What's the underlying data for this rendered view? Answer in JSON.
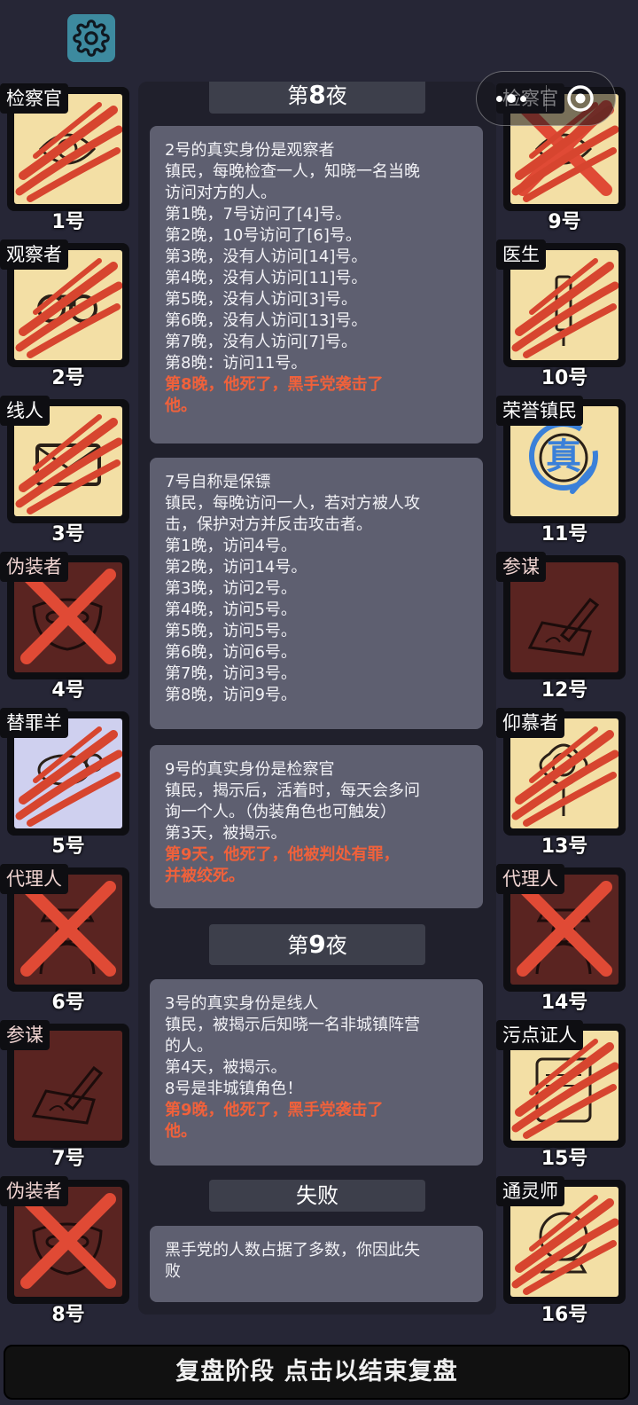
{
  "settings_icon": "gear-icon",
  "capsule": {
    "more_icon": "more-dots-icon",
    "close_icon": "record-close-icon"
  },
  "players": [
    {
      "role": "检察官",
      "number": "1号",
      "team_color": "#ffffff",
      "portrait": "cream",
      "status": "claw",
      "icon": "badge-icon"
    },
    {
      "role": "观察者",
      "number": "2号",
      "team_color": "#ffffff",
      "portrait": "cream",
      "status": "claw",
      "icon": "binoculars-icon"
    },
    {
      "role": "线人",
      "number": "3号",
      "team_color": "#ffffff",
      "portrait": "cream",
      "status": "claw",
      "icon": "envelope-icon"
    },
    {
      "role": "伪装者",
      "number": "4号",
      "team_color": "#f1d5d2",
      "portrait": "maroon",
      "status": "cross",
      "icon": "mask-icon"
    },
    {
      "role": "替罪羊",
      "number": "5号",
      "team_color": "#ffffff",
      "portrait": "lav",
      "status": "claw",
      "icon": "sheep-icon"
    },
    {
      "role": "代理人",
      "number": "6号",
      "team_color": "#f1d5d2",
      "portrait": "maroon",
      "status": "cross",
      "icon": "agent-icon"
    },
    {
      "role": "参谋",
      "number": "7号",
      "team_color": "#f1d5d2",
      "portrait": "maroon",
      "status": "none",
      "icon": "pen-icon"
    },
    {
      "role": "伪装者",
      "number": "8号",
      "team_color": "#f1d5d2",
      "portrait": "maroon",
      "status": "cross",
      "icon": "mask-icon"
    },
    {
      "role": "检察官",
      "number": "9号",
      "team_color": "#ffffff",
      "portrait": "cream",
      "status": "cross-claw",
      "icon": "badge-icon"
    },
    {
      "role": "医生",
      "number": "10号",
      "team_color": "#ffffff",
      "portrait": "cream",
      "status": "claw",
      "icon": "syringe-icon"
    },
    {
      "role": "荣誉镇民",
      "number": "11号",
      "team_color": "#ffffff",
      "portrait": "cream",
      "status": "true-seal",
      "icon": "medal-icon",
      "seal_text": "真"
    },
    {
      "role": "参谋",
      "number": "12号",
      "team_color": "#f1d5d2",
      "portrait": "maroon",
      "status": "none",
      "icon": "pen-icon"
    },
    {
      "role": "仰慕者",
      "number": "13号",
      "team_color": "#ffffff",
      "portrait": "cream",
      "status": "claw",
      "icon": "flower-icon"
    },
    {
      "role": "代理人",
      "number": "14号",
      "team_color": "#f1d5d2",
      "portrait": "maroon",
      "status": "cross",
      "icon": "agent-icon"
    },
    {
      "role": "污点证人",
      "number": "15号",
      "team_color": "#ffffff",
      "portrait": "cream",
      "status": "claw",
      "icon": "scroll-icon"
    },
    {
      "role": "通灵师",
      "number": "16号",
      "team_color": "#ffffff",
      "portrait": "cream",
      "status": "claw",
      "icon": "crystal-ball-icon"
    }
  ],
  "log": {
    "night8": {
      "prefix": "第",
      "num": "8",
      "suffix": "夜"
    },
    "entry1": [
      "2号的真实身份是观察者",
      "镇民，每晚检查一人，知晓一名当晚",
      "访问对方的人。",
      "第1晚，7号访问了[4]号。",
      "第2晚，10号访问了[6]号。",
      "第3晚，没有人访问[14]号。",
      "第4晚，没有人访问[11]号。",
      "第5晚，没有人访问[3]号。",
      "第6晚，没有人访问[13]号。",
      "第7晚，没有人访问[7]号。",
      "第8晚：访问11号。"
    ],
    "entry1_red": [
      "第8晚，他死了，黑手党袭击了",
      "他。"
    ],
    "entry2": [
      "7号自称是保镖",
      "镇民，每晚访问一人，若对方被人攻",
      "击，保护对方并反击攻击者。",
      "第1晚，访问4号。",
      "第2晚，访问14号。",
      "第3晚，访问2号。",
      "第4晚，访问5号。",
      "第5晚，访问5号。",
      "第6晚，访问6号。",
      "第7晚，访问3号。",
      "第8晚，访问9号。"
    ],
    "entry3": [
      "9号的真实身份是检察官",
      "镇民，揭示后，活着时，每天会多问",
      "询一个人。（伪装角色也可触发）",
      "第3天，被揭示。"
    ],
    "entry3_red": [
      "第9天，他死了，他被判处有罪，",
      "并被绞死。"
    ],
    "night9": {
      "prefix": "第",
      "num": "9",
      "suffix": "夜"
    },
    "entry4": [
      "3号的真实身份是线人",
      "镇民，被揭示后知晓一名非城镇阵营",
      "的人。",
      "第4天，被揭示。",
      "8号是非城镇角色！"
    ],
    "entry4_red": [
      "第9晚，他死了，黑手党袭击了",
      "他。"
    ],
    "result_header": "失败",
    "entry5": [
      "黑手党的人数占据了多数，你因此失",
      "败"
    ]
  },
  "bottom_bar": "复盘阶段 点击以结束复盘",
  "colors": {
    "background": "#262636",
    "entry_bg": "#5e5f70",
    "death_text": "#f0613b",
    "claw": "#d7452f",
    "cross": "#e04a35",
    "seal": "#3a80d9"
  }
}
